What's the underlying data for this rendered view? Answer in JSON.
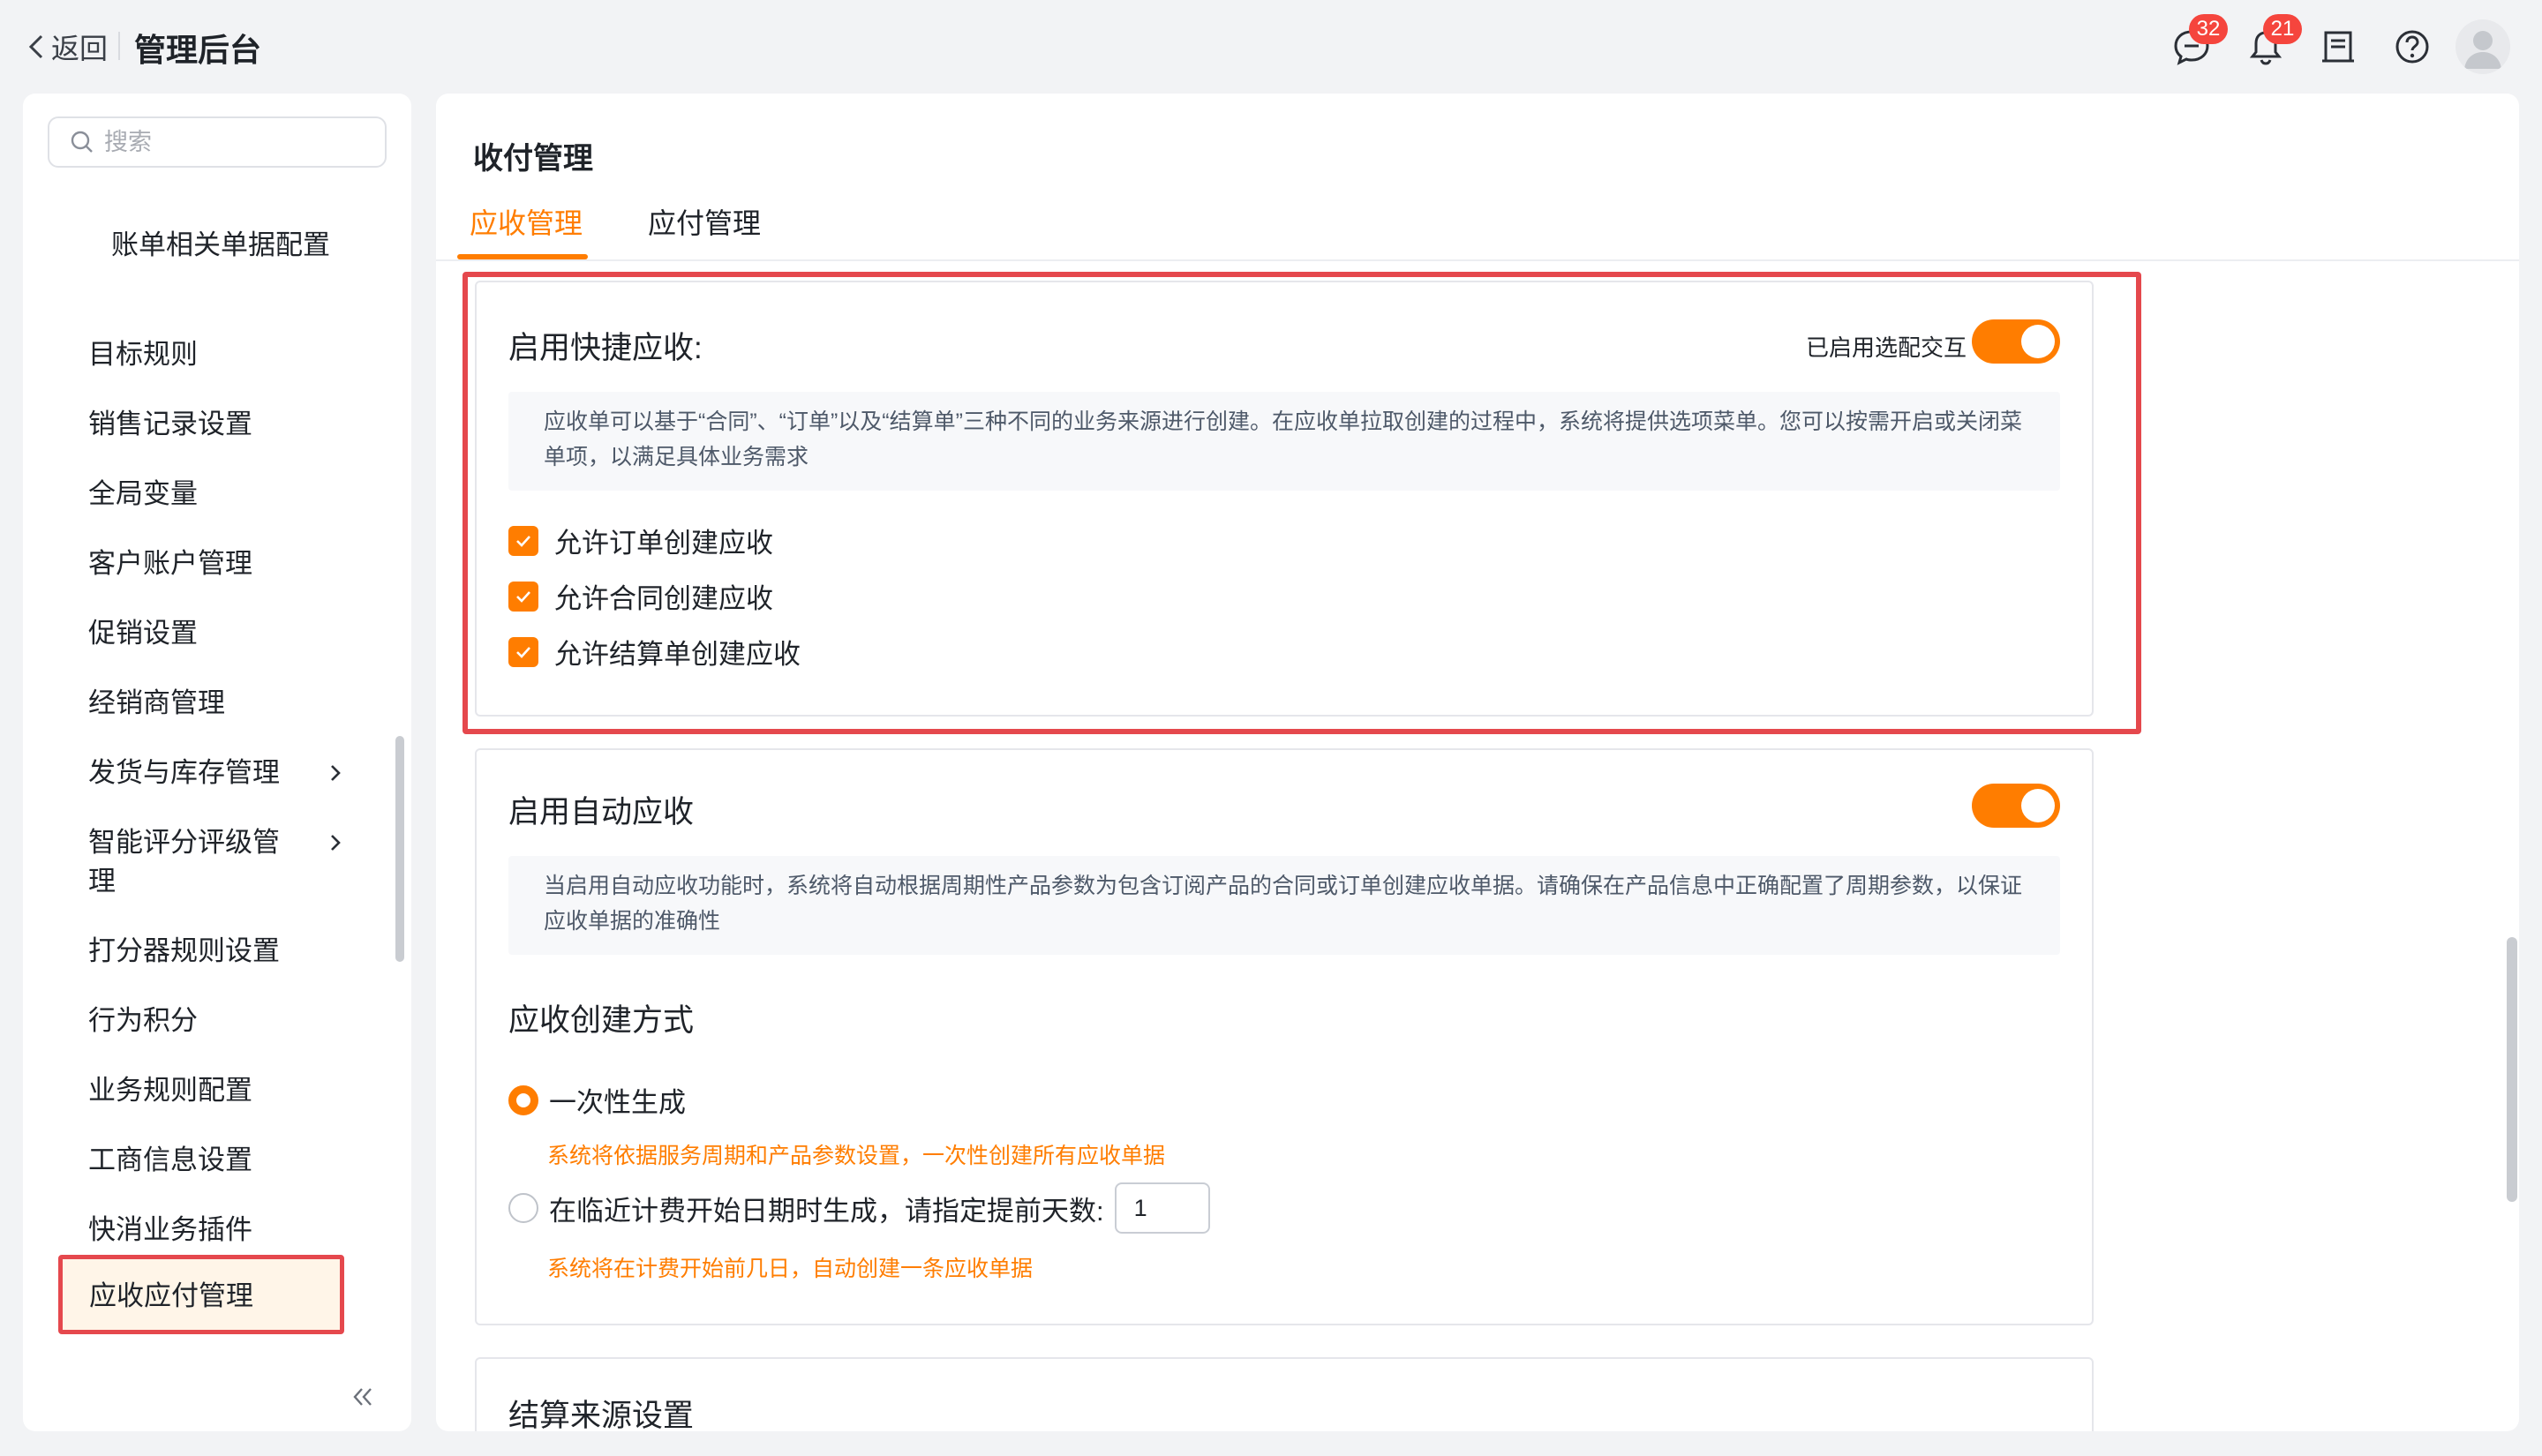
{
  "header": {
    "back_label": "返回",
    "title": "管理后台",
    "icons": [
      {
        "name": "chat-icon",
        "badge": "32"
      },
      {
        "name": "bell-icon",
        "badge": "21"
      },
      {
        "name": "notes-icon"
      },
      {
        "name": "help-icon"
      },
      {
        "name": "avatar"
      }
    ]
  },
  "sidebar": {
    "search_placeholder": "搜索",
    "items": [
      {
        "label": "账单相关单据配置"
      },
      {
        "label": "目标规则"
      },
      {
        "label": "销售记录设置"
      },
      {
        "label": "全局变量"
      },
      {
        "label": "客户账户管理"
      },
      {
        "label": "促销设置"
      },
      {
        "label": "经销商管理"
      },
      {
        "label": "发货与库存管理",
        "has_children": true
      },
      {
        "label": "智能评分评级管理",
        "has_children": true
      },
      {
        "label": "打分器规则设置"
      },
      {
        "label": "行为积分"
      },
      {
        "label": "业务规则配置"
      },
      {
        "label": "工商信息设置"
      },
      {
        "label": "快消业务插件"
      },
      {
        "label": "应收应付管理",
        "active": true
      }
    ]
  },
  "main": {
    "page_title": "收付管理",
    "tabs": [
      {
        "label": "应收管理",
        "active": true
      },
      {
        "label": "应付管理",
        "active": false
      }
    ],
    "quick_receivable": {
      "title": "启用快捷应收:",
      "toggle_label": "已启用选配交互",
      "toggle_on": true,
      "description": "应收单可以基于“合同”、“订单”以及“结算单”三种不同的业务来源进行创建。在应收单拉取创建的过程中，系统将提供选项菜单。您可以按需开启或关闭菜单项，以满足具体业务需求",
      "options": [
        {
          "label": "允许订单创建应收",
          "checked": true
        },
        {
          "label": "允许合同创建应收",
          "checked": true
        },
        {
          "label": "允许结算单创建应收",
          "checked": true
        }
      ]
    },
    "auto_receivable": {
      "title": "启用自动应收",
      "toggle_on": true,
      "description": "当启用自动应收功能时，系统将自动根据周期性产品参数为包含订阅产品的合同或订单创建应收单据。请确保在产品信息中正确配置了周期参数，以保证应收单据的准确性",
      "method_title": "应收创建方式",
      "methods": [
        {
          "label": "一次性生成",
          "selected": true,
          "hint": "系统将依据服务周期和产品参数设置，一次性创建所有应收单据"
        },
        {
          "label": "在临近计费开始日期时生成，请指定提前天数:",
          "selected": false,
          "hint": "系统将在计费开始前几日，自动创建一条应收单据",
          "days_value": "1"
        }
      ]
    },
    "settlement_source": {
      "title": "结算来源设置"
    }
  },
  "colors": {
    "accent": "#ff7d00",
    "highlight_border": "#e5484d",
    "badge": "#f5453d",
    "active_menu_bg": "#fff5e8"
  }
}
